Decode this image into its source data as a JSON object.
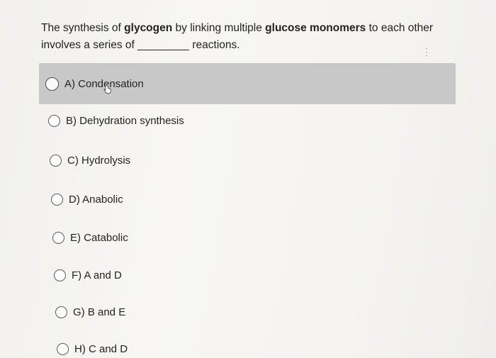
{
  "question": {
    "part1": "The synthesis of ",
    "bold1": "glycogen",
    "part2": " by linking multiple ",
    "bold2": "glucose monomers",
    "part3": " to each other involves a series of ",
    "blank": "________",
    "part4": " reactions."
  },
  "options": [
    {
      "label": "A) Condensation",
      "selected": true
    },
    {
      "label": "B) Dehydration synthesis",
      "selected": false
    },
    {
      "label": "C) Hydrolysis",
      "selected": false
    },
    {
      "label": "D) Anabolic",
      "selected": false
    },
    {
      "label": "E) Catabolic",
      "selected": false
    },
    {
      "label": "F) A and D",
      "selected": false
    },
    {
      "label": "G) B and E",
      "selected": false
    },
    {
      "label": "H) C and D",
      "selected": false
    }
  ],
  "colors": {
    "selected_bg": "#c8c8c8",
    "text": "#222222"
  }
}
